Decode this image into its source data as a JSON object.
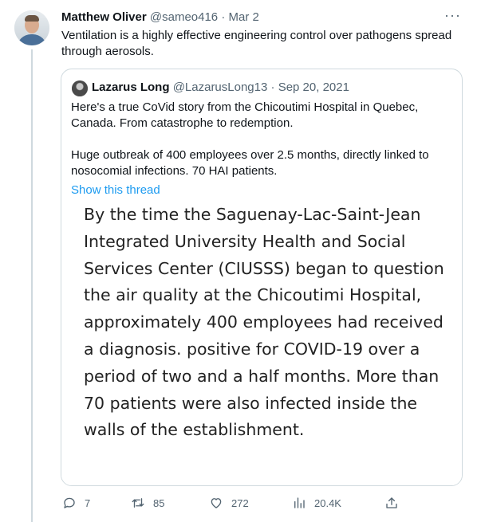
{
  "tweet": {
    "author_name": "Matthew Oliver",
    "author_handle": "@sameo416",
    "separator": "·",
    "date": "Mar 2",
    "more": "···",
    "text": "Ventilation is a highly effective engineering control over pathogens spread through aerosols."
  },
  "quote": {
    "author_name": "Lazarus Long",
    "author_handle": "@LazarusLong13",
    "separator": "·",
    "date": "Sep 20, 2021",
    "paragraph1": "Here's a true CoVid story from the Chicoutimi Hospital in Quebec, Canada.  From catastrophe to redemption.",
    "paragraph2": "Huge outbreak of 400 employees over 2.5 months, directly linked to nosocomial infections.  70 HAI patients.",
    "show_thread": "Show this thread",
    "image_text": "By the time the Saguenay-Lac-Saint-Jean Integrated University Health and Social Services Center (CIUSSS) began to question the air quality at the Chicoutimi Hospital, approximately 400 employees had received a diagnosis. positive for COVID-19 over a period of two and a half months. More than 70 patients were also infected inside the walls of the establishment."
  },
  "actions": {
    "replies": "7",
    "retweets": "85",
    "likes": "272",
    "views": "20.4K"
  },
  "icons": {
    "reply": "reply-icon",
    "retweet": "retweet-icon",
    "like": "heart-icon",
    "views": "views-icon",
    "share": "share-icon"
  },
  "colors": {
    "link": "#1d9bf0",
    "secondary_text": "#536471",
    "border": "#cfd9de"
  }
}
